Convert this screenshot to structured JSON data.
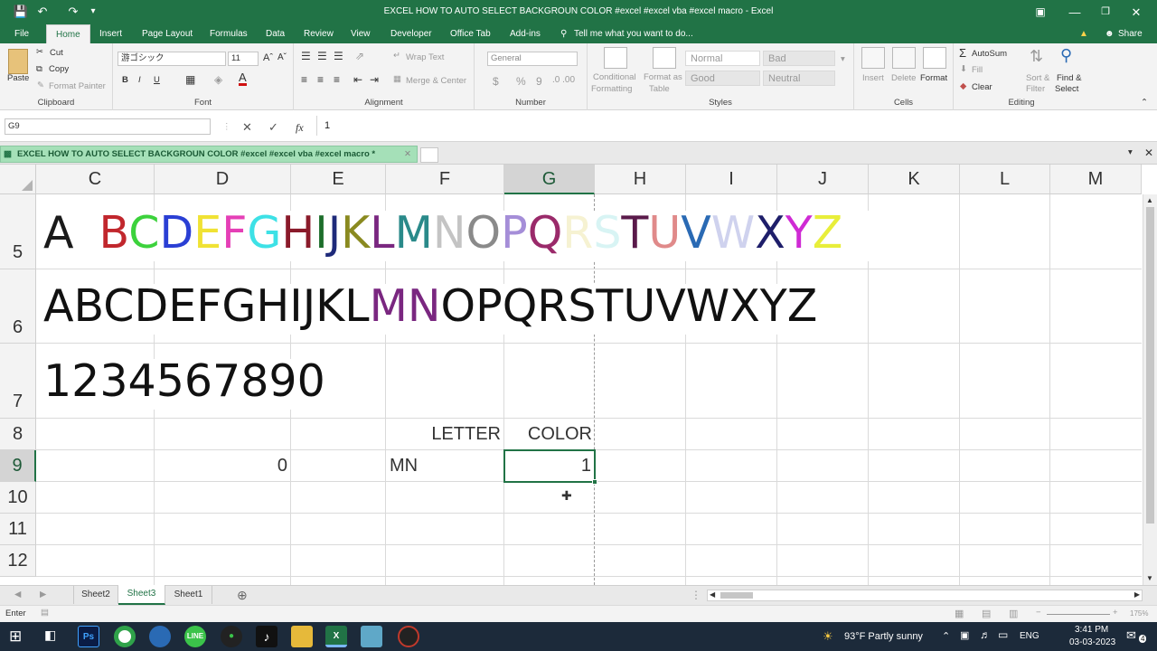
{
  "titlebar": {
    "title": "EXCEL HOW TO AUTO SELECT BACKGROUN  COLOR #excel  #excel vba #excel macro - Excel"
  },
  "ribbon": {
    "tabs": [
      "File",
      "Home",
      "Insert",
      "Page Layout",
      "Formulas",
      "Data",
      "Review",
      "View",
      "Developer",
      "Office Tab",
      "Add-ins"
    ],
    "tell_me": "Tell me what you want to do...",
    "share": "Share",
    "clipboard": {
      "paste": "Paste",
      "cut": "Cut",
      "copy": "Copy",
      "format_painter": "Format Painter",
      "label": "Clipboard"
    },
    "font": {
      "name": "游ゴシック",
      "size": "11",
      "bold": "B",
      "italic": "I",
      "underline": "U",
      "color_letter": "A",
      "label": "Font"
    },
    "alignment": {
      "wrap": "Wrap Text",
      "merge": "Merge & Center",
      "label": "Alignment"
    },
    "number": {
      "format": "General",
      "currency": "$",
      "percent": "%",
      "comma": "9",
      "label": "Number"
    },
    "styles": {
      "cond1": "Conditional",
      "cond2": "Formatting",
      "tbl1": "Format as",
      "tbl2": "Table",
      "normal": "Normal",
      "bad": "Bad",
      "good": "Good",
      "neutral": "Neutral",
      "label": "Styles"
    },
    "cells": {
      "insert": "Insert",
      "delete": "Delete",
      "format": "Format",
      "label": "Cells"
    },
    "editing": {
      "autosum": "AutoSum",
      "fill": "Fill",
      "clear": "Clear",
      "sort1": "Sort &",
      "sort2": "Filter",
      "find1": "Find &",
      "find2": "Select",
      "label": "Editing"
    }
  },
  "formula_bar": {
    "name_box": "G9",
    "fx": "fx",
    "value": "1"
  },
  "workbook_tab": "EXCEL HOW TO AUTO SELECT BACKGROUN  COLOR #excel  #excel vba #excel macro *",
  "columns": [
    "C",
    "D",
    "E",
    "F",
    "G",
    "H",
    "I",
    "J",
    "K",
    "L",
    "M"
  ],
  "rows": [
    "5",
    "6",
    "7",
    "8",
    "9",
    "10",
    "11",
    "12"
  ],
  "cells": {
    "row5_letters": [
      {
        "ch": "A",
        "color": "#1a1a1a"
      },
      {
        "ch": "B",
        "color": "#c1272d"
      },
      {
        "ch": "C",
        "color": "#3cd23c"
      },
      {
        "ch": "D",
        "color": "#2a3fd4"
      },
      {
        "ch": "E",
        "color": "#f0e234"
      },
      {
        "ch": "F",
        "color": "#e53fb6"
      },
      {
        "ch": "G",
        "color": "#3de1e6"
      },
      {
        "ch": "H",
        "color": "#8a1a2a"
      },
      {
        "ch": "I",
        "color": "#1d6e2b"
      },
      {
        "ch": "J",
        "color": "#1e2a7a"
      },
      {
        "ch": "K",
        "color": "#8a8a20"
      },
      {
        "ch": "L",
        "color": "#7a2780"
      },
      {
        "ch": "M",
        "color": "#2a8a8a"
      },
      {
        "ch": "N",
        "color": "#c4c4c4"
      },
      {
        "ch": "O",
        "color": "#8a8a8a"
      },
      {
        "ch": "P",
        "color": "#a58ed8"
      },
      {
        "ch": "Q",
        "color": "#9a2a6a"
      },
      {
        "ch": "R",
        "color": "#f6f2d2"
      },
      {
        "ch": "S",
        "color": "#d8f4f4"
      },
      {
        "ch": "T",
        "color": "#5a1a4a"
      },
      {
        "ch": "U",
        "color": "#e08a8a"
      },
      {
        "ch": "V",
        "color": "#2a6ab4"
      },
      {
        "ch": "W",
        "color": "#cfd2ee"
      },
      {
        "ch": "X",
        "color": "#1e1e6a"
      },
      {
        "ch": "Y",
        "color": "#cf2ad4"
      },
      {
        "ch": "Z",
        "color": "#e8ee3a"
      }
    ],
    "row6_letters": [
      {
        "ch": "A",
        "color": "#111"
      },
      {
        "ch": "B",
        "color": "#111"
      },
      {
        "ch": "C",
        "color": "#111"
      },
      {
        "ch": "D",
        "color": "#111"
      },
      {
        "ch": "E",
        "color": "#111"
      },
      {
        "ch": "F",
        "color": "#111"
      },
      {
        "ch": "G",
        "color": "#111"
      },
      {
        "ch": "H",
        "color": "#111"
      },
      {
        "ch": "I",
        "color": "#111"
      },
      {
        "ch": "J",
        "color": "#111"
      },
      {
        "ch": "K",
        "color": "#111"
      },
      {
        "ch": "L",
        "color": "#111"
      },
      {
        "ch": "M",
        "color": "#7a2780"
      },
      {
        "ch": "N",
        "color": "#7a2780"
      },
      {
        "ch": "O",
        "color": "#111"
      },
      {
        "ch": "P",
        "color": "#111"
      },
      {
        "ch": "Q",
        "color": "#111"
      },
      {
        "ch": "R",
        "color": "#111"
      },
      {
        "ch": "S",
        "color": "#111"
      },
      {
        "ch": "T",
        "color": "#111"
      },
      {
        "ch": "U",
        "color": "#111"
      },
      {
        "ch": "V",
        "color": "#111"
      },
      {
        "ch": "W",
        "color": "#111"
      },
      {
        "ch": "X",
        "color": "#111"
      },
      {
        "ch": "Y",
        "color": "#111"
      },
      {
        "ch": "Z",
        "color": "#111"
      }
    ],
    "row7": "1234567890",
    "f8": "LETTER",
    "g8": "COLOR",
    "d9": "0",
    "f9": "MN",
    "g9": "1"
  },
  "sheets": [
    "Sheet2",
    "Sheet3",
    "Sheet1"
  ],
  "active_sheet": "Sheet3",
  "status": {
    "mode": "Enter",
    "zoom": "175%"
  },
  "taskbar": {
    "weather": "93°F  Partly sunny",
    "lang": "ENG",
    "time": "3:41 PM",
    "date": "03-03-2023",
    "notif": "4"
  },
  "colors": {
    "excel_green": "#217346",
    "taskbar": "#1c2a3a"
  }
}
